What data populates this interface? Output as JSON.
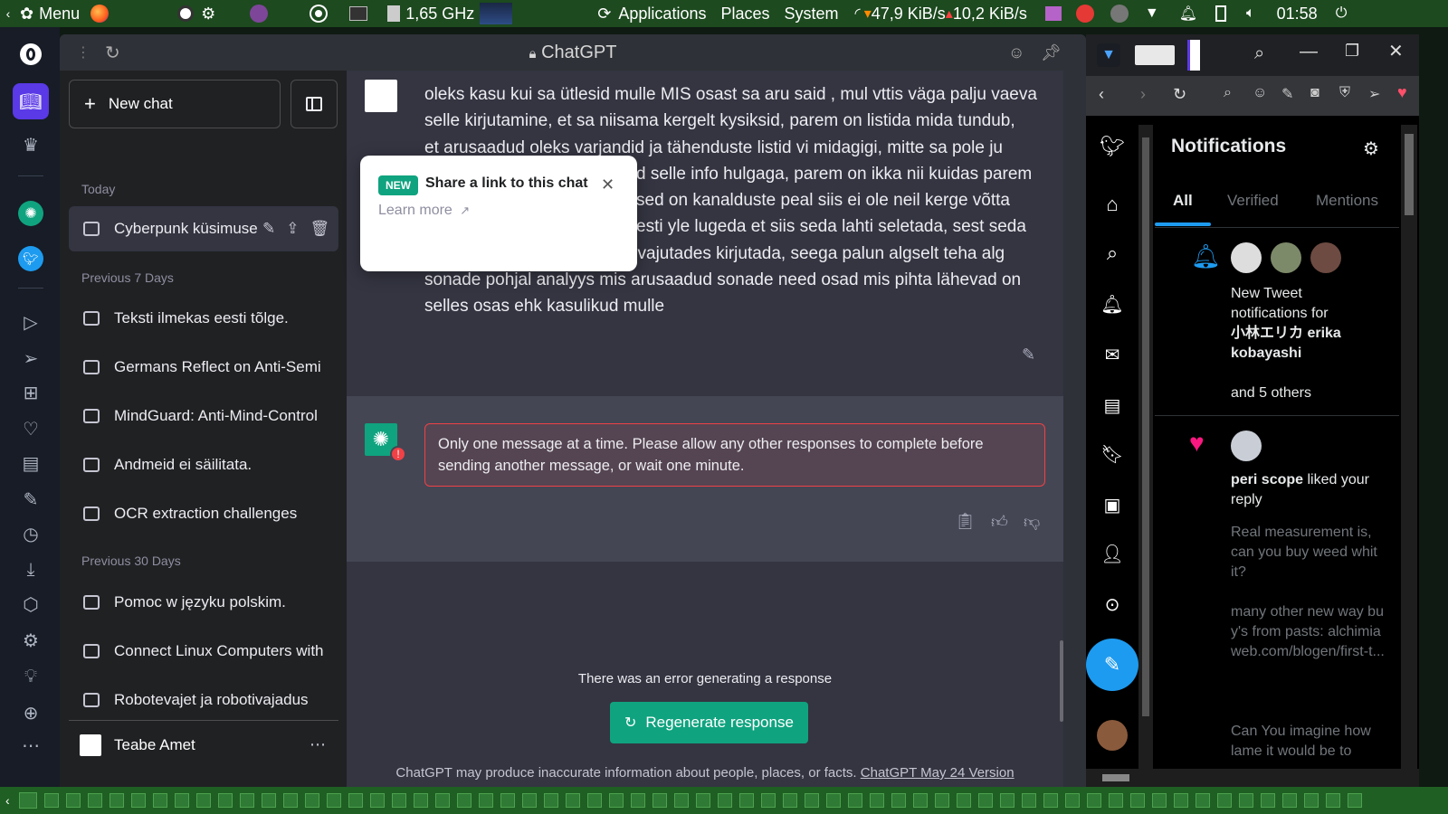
{
  "system_panel": {
    "menu_label": "Menu",
    "cpu_freq": "1,65 GHz",
    "applications": "Applications",
    "places": "Places",
    "system": "System",
    "net_down": "47,9 KiB/s",
    "net_up": "10,2 KiB/s",
    "clock": "01:58"
  },
  "browser": {
    "page_title": "ChatGPT"
  },
  "sidebar": {
    "new_chat": "New chat",
    "sections": {
      "today": "Today",
      "prev7": "Previous 7 Days",
      "prev30": "Previous 30 Days"
    },
    "today_items": [
      {
        "label": "Cyberpunk küsimuse"
      }
    ],
    "prev7_items": [
      {
        "label": "Teksti ilmekas eesti tõlge."
      },
      {
        "label": "Germans Reflect on Anti-Semi"
      },
      {
        "label": "MindGuard: Anti-Mind-Control"
      },
      {
        "label": "Andmeid ei säilitata."
      },
      {
        "label": "OCR extraction challenges"
      }
    ],
    "prev30_items": [
      {
        "label": "Pomoc w języku polskim."
      },
      {
        "label": "Connect Linux Computers with"
      },
      {
        "label": "Robotevajet ja robotivajadus"
      }
    ],
    "user_name": "Teabe Amet"
  },
  "chat": {
    "user_lines": [
      "oleks kasu kui sa ütlesid mulle MIS osast sa aru said , mul vttis väga palju vaeva",
      "selle kirjutamine, et sa niisama kergelt kysiksid, parem on listida mida tundub,",
      "et arusaadud oleks varjandid ja tähenduste listid vi midagigi, mitte sa pole ju",
      "d selle info hulgaga, parem on ikka nii kuidas parem",
      "sed on kanalduste peal siis ei ole neil kerge võtta",
      "esti yle lugeda et siis seda lahti seletada, sest seda",
      "oli niigi raske klahve oigesti vajutades kirjutada, seega palun algselt teha alg",
      "sonade pohjal analyys mis arusaadud sonade need osad mis pihta lähevad on",
      "selles osas ehk kasulikud mulle"
    ],
    "error_text": "Only one message at a time. Please allow any other responses to complete before sending another message, or wait one minute.",
    "gen_error": "There was an error generating a response",
    "regenerate": "Regenerate response",
    "disclaimer": "ChatGPT may produce inaccurate information about people, places, or facts.",
    "version_link": "ChatGPT May 24 Version",
    "popover": {
      "badge": "NEW",
      "title": "Share a link to this chat",
      "learn_more": "Learn more"
    }
  },
  "twitter": {
    "title": "Notifications",
    "tabs": [
      "All",
      "Verified",
      "Mentions"
    ],
    "notif1": {
      "line1": "New Tweet",
      "line2": "notifications for",
      "name": "小林エリカ erika kobayashi",
      "others": "and 5 others"
    },
    "notif2": {
      "name": "peri scope",
      "action": "liked your reply",
      "quote1": "Real measurement is, can you buy weed whit it?",
      "quote2": "many other new way buy's from pasts: alchimiaweb.com/blogen/first-t...",
      "quote3": "Can You imagine how lame it would be to"
    },
    "accent": "#1d9bf0"
  },
  "colors": {
    "chatgpt_green": "#10a37f",
    "error_red": "#ef4146",
    "panel_green": "#1d4a1f"
  }
}
